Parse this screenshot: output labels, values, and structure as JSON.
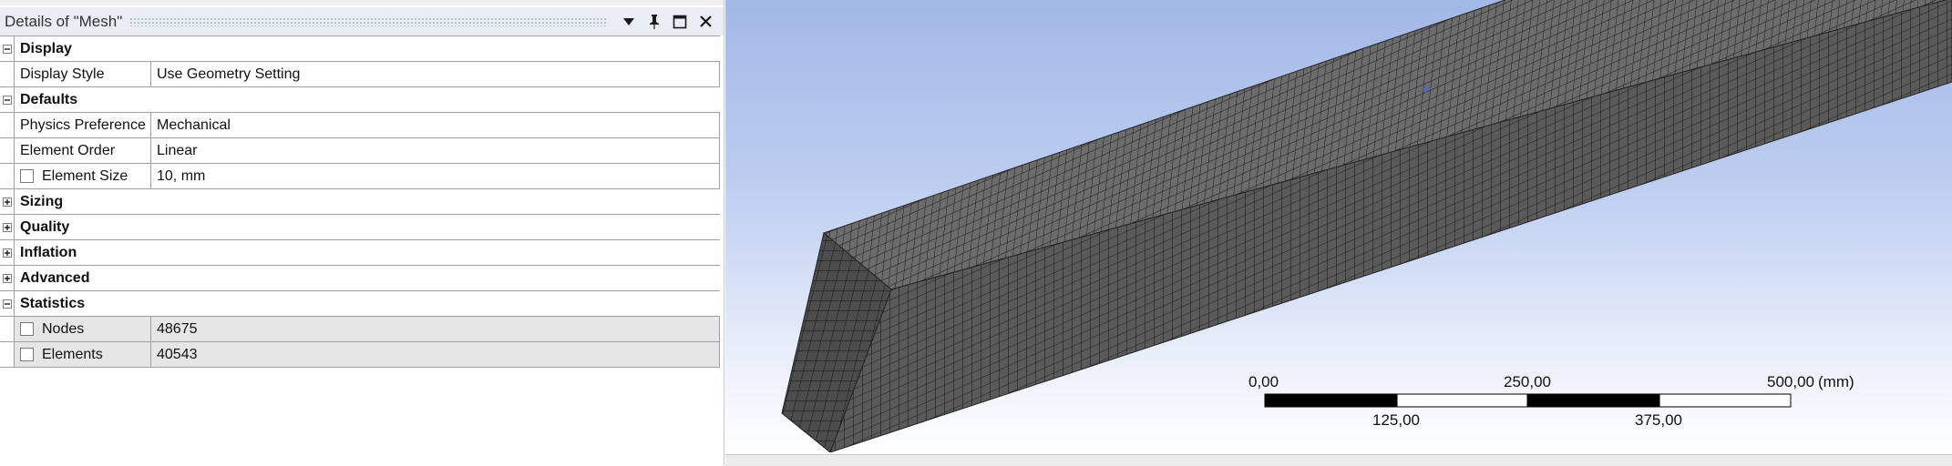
{
  "panel": {
    "title": "Details of \"Mesh\"",
    "icons": [
      "dropdown-arrow-icon",
      "pin-icon",
      "maximize-icon",
      "close-icon"
    ]
  },
  "groups": [
    {
      "label": "Display",
      "expanded": true,
      "props": [
        {
          "name": "Display Style",
          "value": "Use Geometry Setting",
          "checkbox": false,
          "readonly": false
        }
      ]
    },
    {
      "label": "Defaults",
      "expanded": true,
      "props": [
        {
          "name": "Physics Preference",
          "value": "Mechanical",
          "checkbox": false,
          "readonly": false
        },
        {
          "name": "Element Order",
          "value": "Linear",
          "checkbox": false,
          "readonly": false
        },
        {
          "name": "Element Size",
          "value": "10, mm",
          "checkbox": true,
          "readonly": false
        }
      ]
    },
    {
      "label": "Sizing",
      "expanded": false,
      "props": []
    },
    {
      "label": "Quality",
      "expanded": false,
      "props": []
    },
    {
      "label": "Inflation",
      "expanded": false,
      "props": []
    },
    {
      "label": "Advanced",
      "expanded": false,
      "props": []
    },
    {
      "label": "Statistics",
      "expanded": true,
      "props": [
        {
          "name": "Nodes",
          "value": "48675",
          "checkbox": true,
          "readonly": true
        },
        {
          "name": "Elements",
          "value": "40543",
          "checkbox": true,
          "readonly": true
        }
      ]
    }
  ],
  "scale_bar": {
    "unit": "(mm)",
    "top_labels": [
      "0,00",
      "250,00",
      "500,00"
    ],
    "bottom_labels": [
      "125,00",
      "375,00"
    ]
  },
  "colors": {
    "header_bg": "#e9eef5",
    "readonly_bg": "#e6e6e6",
    "viewport_top": "#a2b8e6",
    "mesh_face": "#5a5a5a",
    "mesh_lines": "#1a1a1a"
  }
}
